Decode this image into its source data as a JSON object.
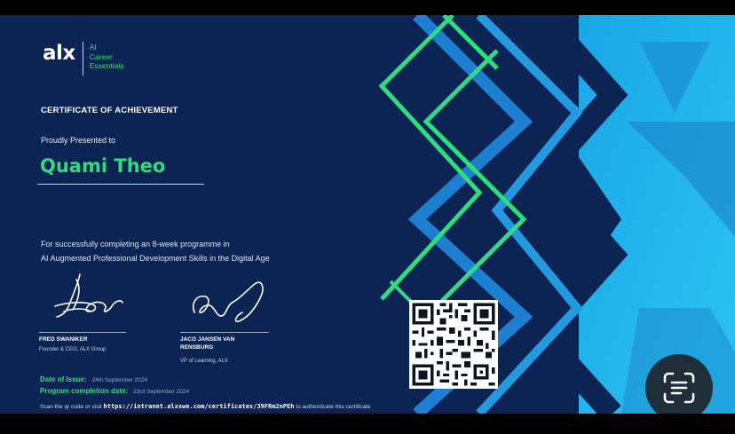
{
  "logo": {
    "mark": "alx",
    "subtitle": [
      "AI",
      "Career",
      "Essentials"
    ]
  },
  "certificate": {
    "title": "CERTIFICATE OF ACHIEVEMENT",
    "presented": "Proudly Presented to",
    "recipient": "Quami Theo",
    "description": [
      "For successfully completing an 8-week programme in",
      "AI Augmented Professional Development Skills in the Digital Age"
    ]
  },
  "signers": [
    {
      "name": "FRED SWANIKER",
      "role": "Founder & CEO, ALX Group"
    },
    {
      "name_lines": [
        "JACO JANSEN VAN",
        "RENSBURG"
      ],
      "role": "VP of Learning, ALX"
    }
  ],
  "dates": {
    "issue_label": "Date of Issue:",
    "issue_value": "24th September 2024",
    "completion_label": "Program completion date:",
    "completion_value": "23rd September 2024"
  },
  "footer": {
    "prefix": "Scan the qr code or visit",
    "url": "https://intranet.alxswe.com/certificates/39FRm2nPEh",
    "suffix": "to authenticate this certificate"
  },
  "colors": {
    "background": "#0b2454",
    "accent_green": "#2fdc7f",
    "accent_blue": "#29b6ee"
  },
  "icons": {
    "qr": "qr-code",
    "scan": "lens-scan-icon"
  }
}
